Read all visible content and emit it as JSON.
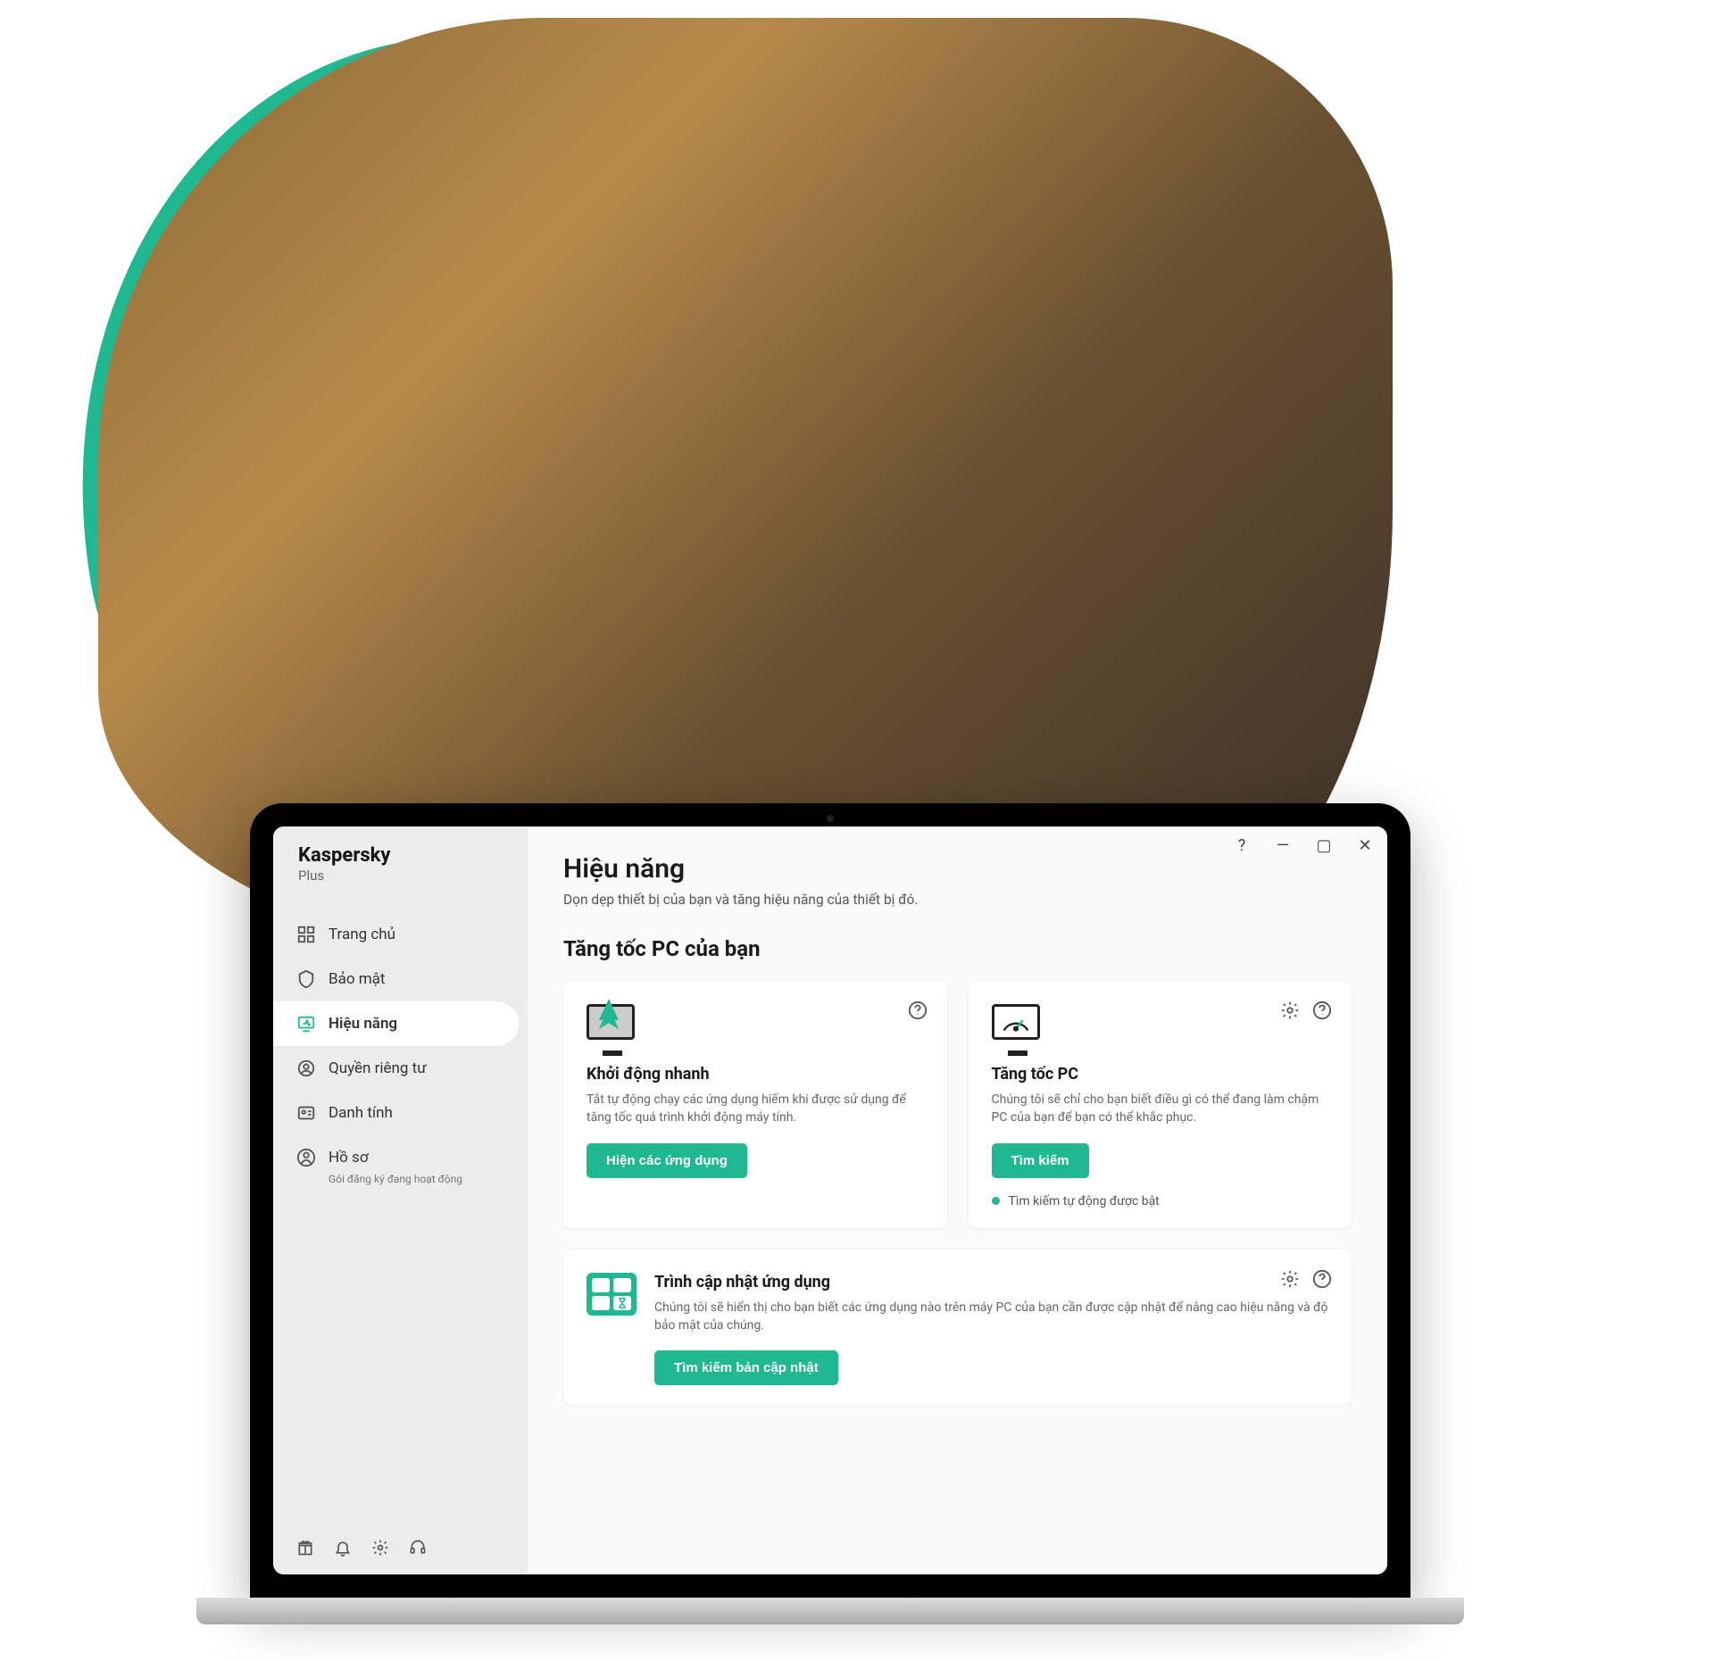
{
  "brand": {
    "name": "Kaspersky",
    "tier": "Plus"
  },
  "titlebar": {
    "help": "?",
    "minimize": "—",
    "maximize": "▢",
    "close": "✕"
  },
  "sidebar": {
    "items": [
      {
        "label": "Trang chủ"
      },
      {
        "label": "Bảo mật"
      },
      {
        "label": "Hiệu năng"
      },
      {
        "label": "Quyền riêng tư"
      },
      {
        "label": "Danh tính"
      },
      {
        "label": "Hồ sơ",
        "sub": "Gói đăng ký đang hoạt động"
      }
    ]
  },
  "page": {
    "title": "Hiệu năng",
    "subtitle": "Dọn dẹp thiết bị của bạn và tăng hiệu năng của thiết bị đó.",
    "section": "Tăng tốc PC của bạn"
  },
  "cards": {
    "quickstart": {
      "title": "Khởi động nhanh",
      "desc": "Tắt tự động chạy các ứng dụng hiếm khi được sử dụng để tăng tốc quá trình khởi động máy tính.",
      "button": "Hiện các ứng dụng"
    },
    "speedup": {
      "title": "Tăng tốc PC",
      "desc": "Chúng tôi sẽ chỉ cho bạn biết điều gì có thể đang làm chậm PC của bạn để bạn có thể khắc phục.",
      "button": "Tìm kiếm",
      "status": "Tìm kiếm tự động được bật"
    },
    "updater": {
      "title": "Trình cập nhật ứng dụng",
      "desc": "Chúng tôi sẽ hiển thị cho bạn biết các ứng dụng nào trên máy PC của bạn cần được cập nhật để nâng cao hiệu năng và độ bảo mật của chúng.",
      "button": "Tìm kiếm bản cập nhật"
    }
  },
  "colors": {
    "accent": "#1fb891"
  }
}
